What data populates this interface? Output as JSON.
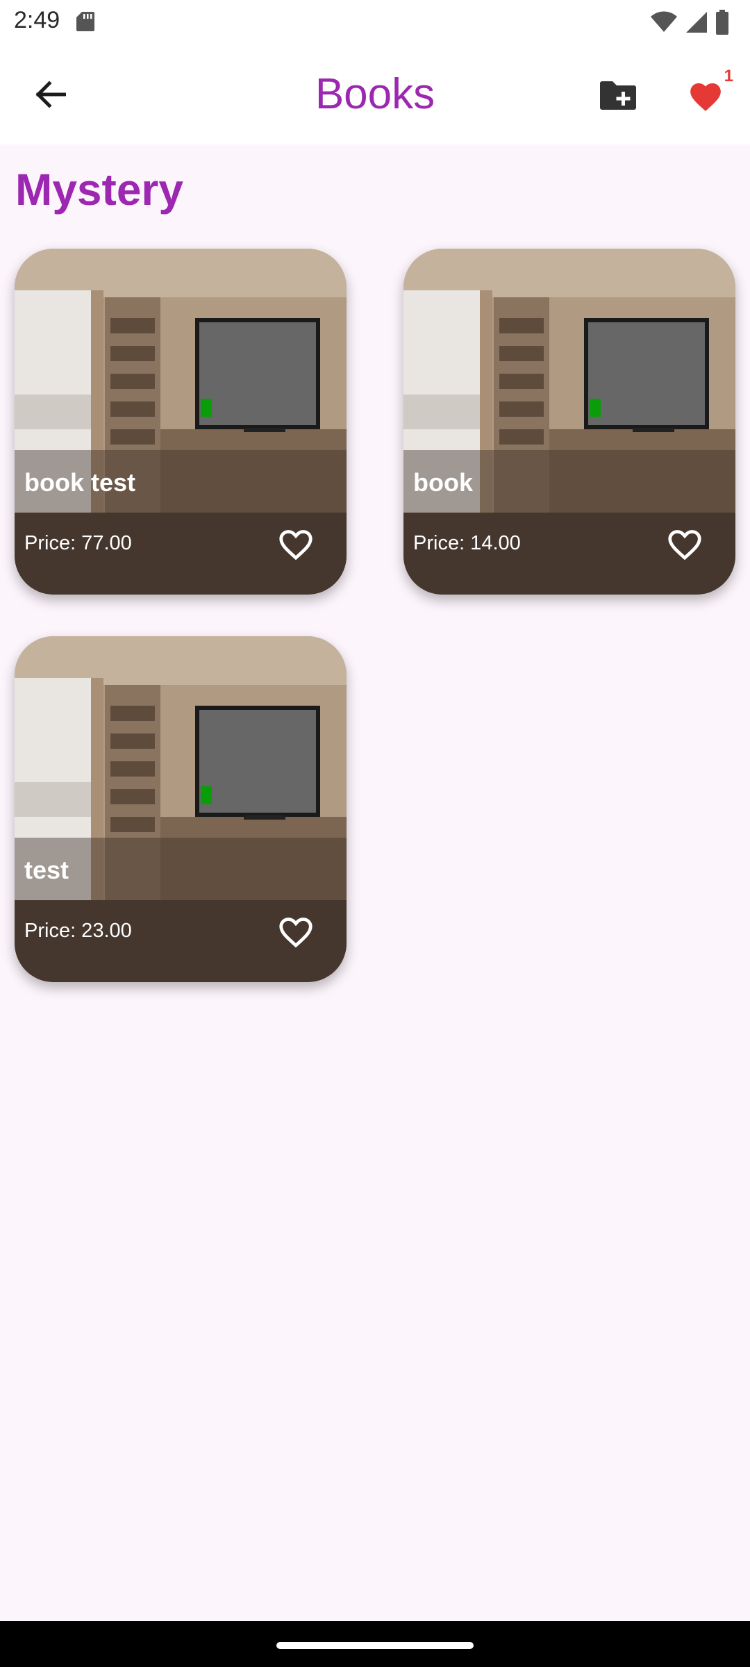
{
  "status_bar": {
    "time": "2:49",
    "icons": [
      "sd-card-icon",
      "wifi-icon",
      "signal-icon",
      "battery-icon"
    ]
  },
  "app_bar": {
    "title": "Books",
    "title_color": "#9c27b0",
    "back_icon": "arrow-left-icon",
    "add_folder_icon": "create-new-folder-icon",
    "favorites_icon": "heart-icon",
    "favorites_count": "1",
    "favorites_color": "#e53935"
  },
  "section": {
    "title": "Mystery"
  },
  "books": [
    {
      "title": "book test",
      "price": "Price: 77.00"
    },
    {
      "title": "book",
      "price": "Price: 14.00"
    },
    {
      "title": "test",
      "price": "Price: 23.00"
    }
  ]
}
